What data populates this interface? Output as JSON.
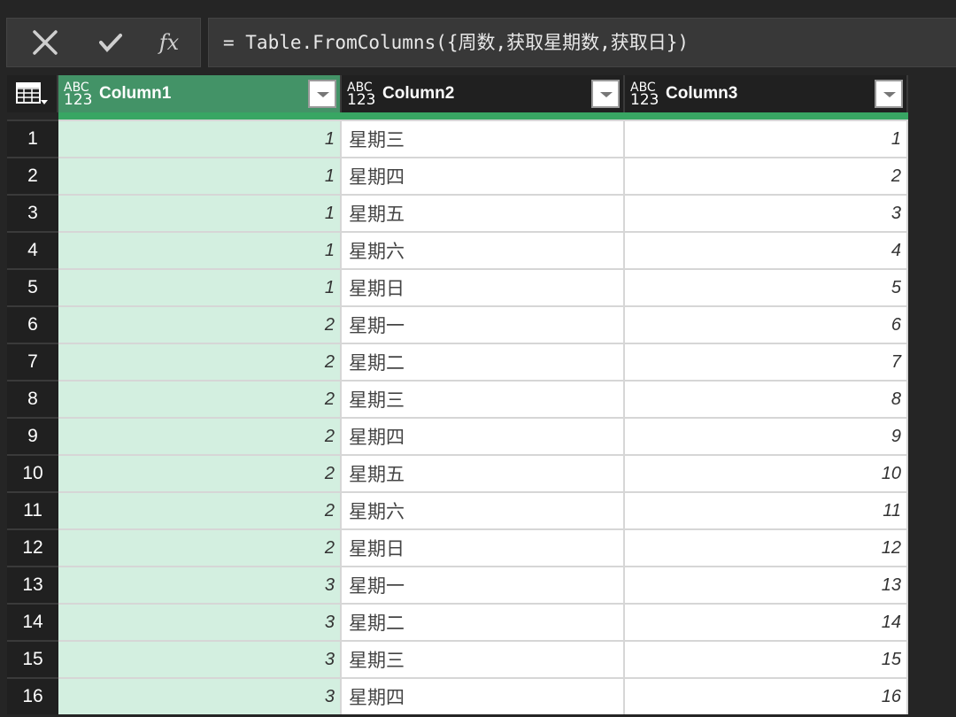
{
  "formula_bar": {
    "cancel_icon": "x-icon",
    "confirm_icon": "check-icon",
    "fx_label": "fx",
    "formula": "= Table.FromColumns({周数,获取星期数,获取日})"
  },
  "columns": [
    {
      "type": "ABC",
      "type2": "123",
      "name": "Column1"
    },
    {
      "type": "ABC",
      "type2": "123",
      "name": "Column2"
    },
    {
      "type": "ABC",
      "type2": "123",
      "name": "Column3"
    }
  ],
  "rows": [
    [
      "1",
      "1",
      "星期三",
      "1"
    ],
    [
      "2",
      "1",
      "星期四",
      "2"
    ],
    [
      "3",
      "1",
      "星期五",
      "3"
    ],
    [
      "4",
      "1",
      "星期六",
      "4"
    ],
    [
      "5",
      "1",
      "星期日",
      "5"
    ],
    [
      "6",
      "2",
      "星期一",
      "6"
    ],
    [
      "7",
      "2",
      "星期二",
      "7"
    ],
    [
      "8",
      "2",
      "星期三",
      "8"
    ],
    [
      "9",
      "2",
      "星期四",
      "9"
    ],
    [
      "10",
      "2",
      "星期五",
      "10"
    ],
    [
      "11",
      "2",
      "星期六",
      "11"
    ],
    [
      "12",
      "2",
      "星期日",
      "12"
    ],
    [
      "13",
      "3",
      "星期一",
      "13"
    ],
    [
      "14",
      "3",
      "星期二",
      "14"
    ],
    [
      "15",
      "3",
      "星期三",
      "15"
    ],
    [
      "16",
      "3",
      "星期四",
      "16"
    ]
  ]
}
